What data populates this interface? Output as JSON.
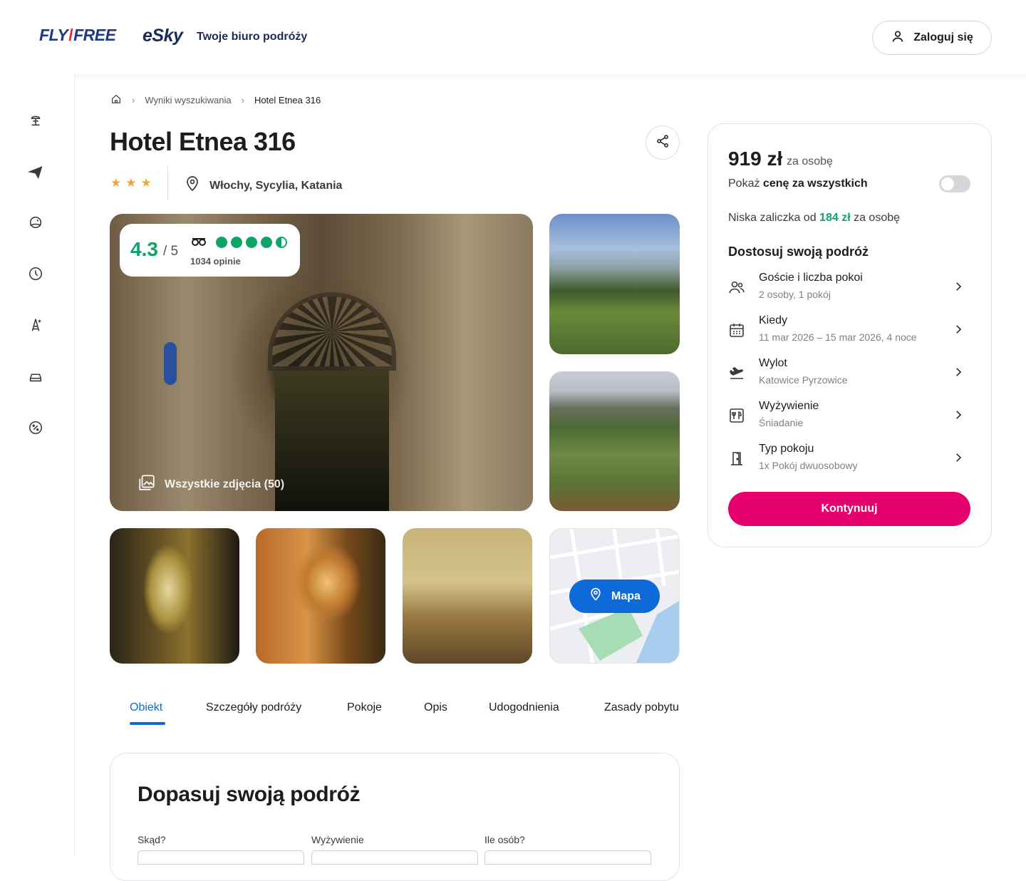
{
  "header": {
    "logo_flyfree_left": "FLY",
    "logo_flyfree_right": "FREE",
    "logo_esky": "eSky",
    "tagline": "Twoje biuro podróży",
    "login_label": "Zaloguj się"
  },
  "sidebar": {
    "items": [
      {
        "icon": "beach-umbrella-icon"
      },
      {
        "icon": "airplane-icon"
      },
      {
        "icon": "island-icon"
      },
      {
        "icon": "clock-icon"
      },
      {
        "icon": "city-icon"
      },
      {
        "icon": "car-icon"
      },
      {
        "icon": "discount-icon"
      }
    ]
  },
  "breadcrumb": {
    "items": [
      "Wyniki wyszukiwania",
      "Hotel Etnea 316"
    ]
  },
  "hotel": {
    "name": "Hotel Etnea 316",
    "stars": 3,
    "location": "Włochy, Sycylia, Katania",
    "rating_value": "4.3",
    "rating_of": "/ 5",
    "reviews_count": "1034 opinie",
    "tripadvisor_score": 4.5,
    "all_photos_label": "Wszystkie zdjęcia (50)",
    "map_label": "Mapa"
  },
  "tabs": [
    {
      "label": "Obiekt",
      "active": true
    },
    {
      "label": "Szczegóły podróży"
    },
    {
      "label": "Pokoje"
    },
    {
      "label": "Opis"
    },
    {
      "label": "Udogodnienia"
    },
    {
      "label": "Zasady pobytu"
    }
  ],
  "fit_section": {
    "title": "Dopasuj swoją podróż",
    "fields": [
      "Skąd?",
      "Wyżywienie",
      "Ile osób?"
    ]
  },
  "price_panel": {
    "amount": "919 zł",
    "per_person": "za osobę",
    "show_all_prefix": "Pokaż ",
    "show_all_bold": "cenę za wszystkich",
    "show_all_enabled": false,
    "deposit_prefix": "Niska zaliczka od ",
    "deposit_amount": "184 zł",
    "deposit_suffix": " za osobę",
    "customize_title": "Dostosuj swoją podróż",
    "options": [
      {
        "label": "Goście i liczba pokoi",
        "value": "2 osoby, 1 pokój",
        "icon": "guests-icon"
      },
      {
        "label": "Kiedy",
        "value": "11 mar 2026 – 15 mar 2026, 4 noce",
        "icon": "calendar-icon"
      },
      {
        "label": "Wylot",
        "value": "Katowice Pyrzowice",
        "icon": "departure-icon"
      },
      {
        "label": "Wyżywienie",
        "value": "Śniadanie",
        "icon": "meal-icon"
      },
      {
        "label": "Typ pokoju",
        "value": "1x Pokój dwuosobowy",
        "icon": "door-icon"
      }
    ],
    "continue_label": "Kontynuuj"
  },
  "colors": {
    "accent_blue": "#0e6ad8",
    "cta_pink": "#e5006e",
    "rating_green": "#10a366",
    "star_orange": "#f2a33a"
  }
}
